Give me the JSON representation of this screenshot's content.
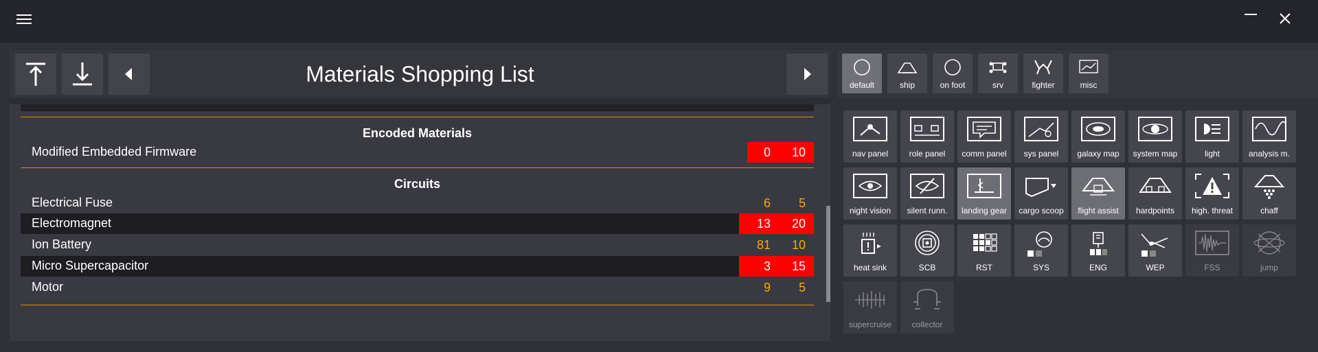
{
  "titlebar": {
    "menu_icon": "hamburger-menu-icon",
    "minimize_icon": "minimize-icon",
    "close_icon": "close-icon"
  },
  "header": {
    "title": "Materials Shopping List",
    "buttons": [
      {
        "icon": "upload-top-icon"
      },
      {
        "icon": "download-bottom-icon"
      },
      {
        "icon": "arrow-left-icon"
      },
      {
        "icon": "arrow-right-icon"
      }
    ]
  },
  "shopping_list": {
    "sections": [
      {
        "title": "Encoded Materials",
        "items": [
          {
            "name": "Modified Embedded Firmware",
            "have": "0",
            "need": "10",
            "shortfall": true
          }
        ]
      },
      {
        "title": "Circuits",
        "items": [
          {
            "name": "Electrical Fuse",
            "have": "6",
            "need": "5",
            "shortfall": false
          },
          {
            "name": "Electromagnet",
            "have": "13",
            "need": "20",
            "shortfall": true
          },
          {
            "name": "Ion Battery",
            "have": "81",
            "need": "10",
            "shortfall": false
          },
          {
            "name": "Micro Supercapacitor",
            "have": "3",
            "need": "15",
            "shortfall": true
          },
          {
            "name": "Motor",
            "have": "9",
            "need": "5",
            "shortfall": false
          }
        ]
      }
    ]
  },
  "categories": [
    {
      "label": "default",
      "icon": "circle-icon",
      "active": true
    },
    {
      "label": "ship",
      "icon": "ship-icon",
      "active": false
    },
    {
      "label": "on foot",
      "icon": "circle-icon",
      "active": false
    },
    {
      "label": "srv",
      "icon": "srv-icon",
      "active": false
    },
    {
      "label": "fighter",
      "icon": "fighter-icon",
      "active": false
    },
    {
      "label": "misc",
      "icon": "misc-icon",
      "active": false
    }
  ],
  "actions": [
    {
      "label": "nav panel",
      "icon": "nav-panel-icon",
      "state": "normal"
    },
    {
      "label": "role panel",
      "icon": "role-panel-icon",
      "state": "normal"
    },
    {
      "label": "comm panel",
      "icon": "comm-panel-icon",
      "state": "normal"
    },
    {
      "label": "sys panel",
      "icon": "sys-panel-icon",
      "state": "normal"
    },
    {
      "label": "galaxy map",
      "icon": "galaxy-map-icon",
      "state": "normal"
    },
    {
      "label": "system map",
      "icon": "system-map-icon",
      "state": "normal"
    },
    {
      "label": "light",
      "icon": "light-icon",
      "state": "normal"
    },
    {
      "label": "analysis m.",
      "icon": "analysis-mode-icon",
      "state": "normal"
    },
    {
      "label": "night vision",
      "icon": "night-vision-icon",
      "state": "normal"
    },
    {
      "label": "silent runn.",
      "icon": "silent-running-icon",
      "state": "normal"
    },
    {
      "label": "landing gear",
      "icon": "landing-gear-icon",
      "state": "active"
    },
    {
      "label": "cargo scoop",
      "icon": "cargo-scoop-icon",
      "state": "normal"
    },
    {
      "label": "flight assist",
      "icon": "flight-assist-icon",
      "state": "active"
    },
    {
      "label": "hardpoints",
      "icon": "hardpoints-icon",
      "state": "normal"
    },
    {
      "label": "high. threat",
      "icon": "high-threat-icon",
      "state": "normal"
    },
    {
      "label": "chaff",
      "icon": "chaff-icon",
      "state": "normal"
    },
    {
      "label": "heat sink",
      "icon": "heat-sink-icon",
      "state": "normal"
    },
    {
      "label": "SCB",
      "icon": "scb-icon",
      "state": "normal"
    },
    {
      "label": "RST",
      "icon": "rst-icon",
      "state": "normal"
    },
    {
      "label": "SYS",
      "icon": "sys-icon",
      "state": "normal"
    },
    {
      "label": "ENG",
      "icon": "eng-icon",
      "state": "normal"
    },
    {
      "label": "WEP",
      "icon": "wep-icon",
      "state": "normal"
    },
    {
      "label": "FSS",
      "icon": "fss-icon",
      "state": "disabled"
    },
    {
      "label": "jump",
      "icon": "jump-icon",
      "state": "disabled"
    },
    {
      "label": "supercruise",
      "icon": "supercruise-icon",
      "state": "disabled"
    },
    {
      "label": "collector",
      "icon": "collector-icon",
      "state": "disabled"
    }
  ]
}
